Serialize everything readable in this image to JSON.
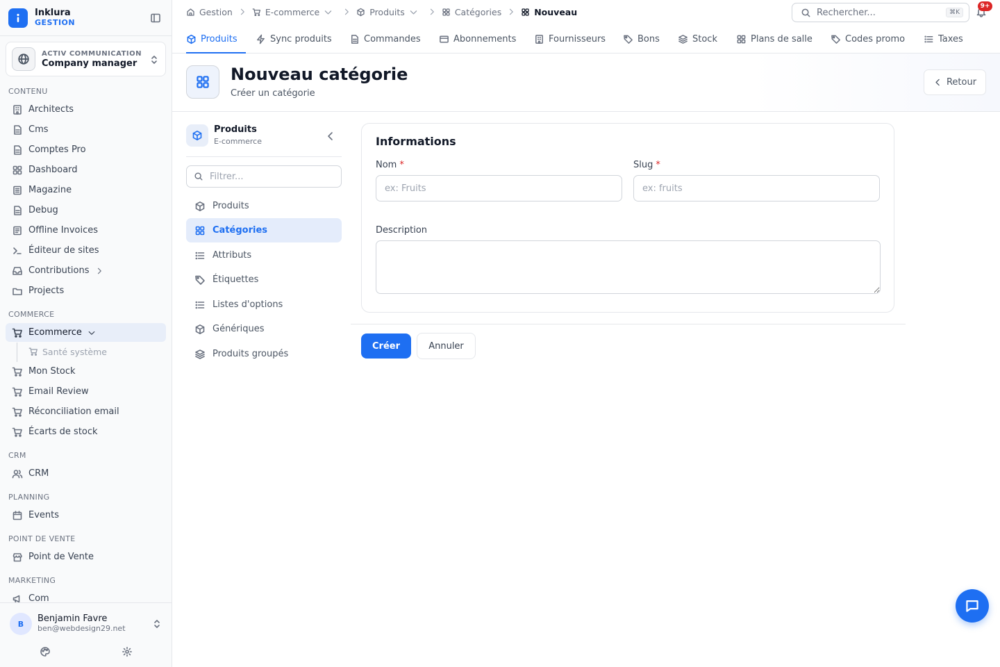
{
  "brand": {
    "name": "Inklura",
    "sub": "GESTION"
  },
  "company": {
    "org": "ACTIV COMMUNICATION",
    "role": "Company manager"
  },
  "sidebar": {
    "sections": {
      "contenu": "CONTENU",
      "commerce": "COMMERCE",
      "crm": "CRM",
      "planning": "PLANNING",
      "pos": "POINT DE VENTE",
      "marketing": "MARKETING"
    },
    "contenu_items": [
      "Architects",
      "Cms",
      "Comptes Pro",
      "Dashboard",
      "Magazine",
      "Debug",
      "Offline Invoices",
      "Éditeur de sites",
      "Contributions",
      "Projects"
    ],
    "commerce_items": [
      "Ecommerce",
      "Santé système",
      "Mon Stock",
      "Email Review",
      "Réconciliation email",
      "Écarts de stock"
    ],
    "crm_items": [
      "CRM"
    ],
    "planning_items": [
      "Events"
    ],
    "pos_items": [
      "Point de Vente"
    ],
    "marketing_items": [
      "Com"
    ]
  },
  "user": {
    "initial": "B",
    "name": "Benjamin Favre",
    "email": "ben@webdesign29.net"
  },
  "breadcrumb": [
    "Gestion",
    "E-commerce",
    "Produits",
    "Catégories",
    "Nouveau"
  ],
  "search": {
    "placeholder": "Rechercher...",
    "shortcut": "⌘K"
  },
  "notifications": {
    "count": "9+"
  },
  "tabs": [
    "Produits",
    "Sync produits",
    "Commandes",
    "Abonnements",
    "Fournisseurs",
    "Bons",
    "Stock",
    "Plans de salle",
    "Codes promo",
    "Taxes"
  ],
  "page": {
    "title": "Nouveau catégorie",
    "subtitle": "Créer un catégorie",
    "back": "Retour"
  },
  "subnav": {
    "title": "Produits",
    "subtitle": "E-commerce",
    "filter_placeholder": "Filtrer...",
    "items": [
      "Produits",
      "Catégories",
      "Attributs",
      "Étiquettes",
      "Listes d'options",
      "Génériques",
      "Produits groupés"
    ]
  },
  "form": {
    "section_title": "Informations",
    "name_label": "Nom",
    "name_placeholder": "ex: Fruits",
    "slug_label": "Slug",
    "slug_placeholder": "ex: fruits",
    "required_mark": "*",
    "description_label": "Description",
    "create_label": "Créer",
    "cancel_label": "Annuler"
  },
  "colors": {
    "accent": "#1e6ff2",
    "danger": "#dc2626",
    "active_bg": "#e4ecfb"
  }
}
